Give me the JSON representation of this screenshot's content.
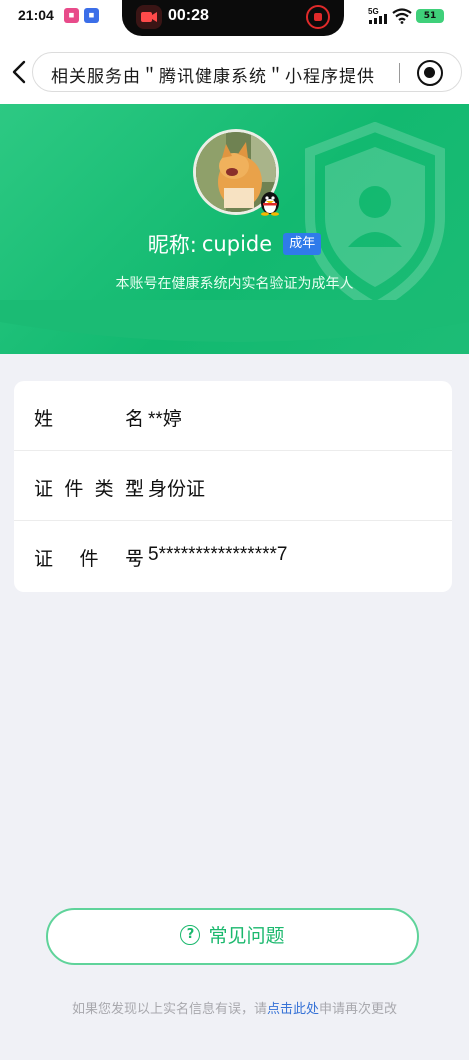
{
  "status_bar": {
    "time": "21:04",
    "record_timer": "00:28",
    "network": "5G",
    "battery": "51"
  },
  "nav": {
    "url_text": "相关服务由＂腾讯健康系统＂小程序提供"
  },
  "profile": {
    "nickname_label": "昵称:",
    "nickname": "cupide",
    "age_badge": "成年",
    "verify_note": "本账号在健康系统内实名验证为成年人"
  },
  "info": {
    "rows": [
      {
        "label": [
          "姓",
          "名"
        ],
        "value": "**婷"
      },
      {
        "label": [
          "证",
          "件",
          "类",
          "型"
        ],
        "value": "身份证"
      },
      {
        "label": [
          "证",
          "件",
          "号"
        ],
        "value": "5****************7"
      }
    ]
  },
  "faq": {
    "label": "常见问题"
  },
  "footer": {
    "prefix": "如果您发现以上实名信息有误，请",
    "link": "点击此处",
    "suffix": "申请再次更改"
  },
  "colors": {
    "brand_green": "#12b970",
    "link_blue": "#3672d6",
    "badge_blue": "#2f7bea"
  }
}
